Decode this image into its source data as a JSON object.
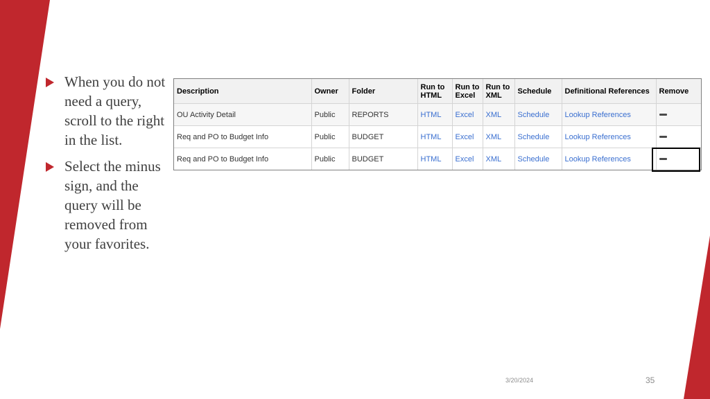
{
  "slide": {
    "bullets": [
      "When you do not need a query, scroll to the right in the list.",
      "Select the minus sign, and the query will be removed from your favorites."
    ],
    "date": "3/20/2024",
    "page_number": "35",
    "accent_color": "#c0272d"
  },
  "favorites_table": {
    "headers": {
      "description": "Description",
      "owner": "Owner",
      "folder": "Folder",
      "run_html": "Run to HTML",
      "run_excel": "Run to Excel",
      "run_xml": "Run to XML",
      "schedule": "Schedule",
      "definitional_references": "Definitional References",
      "remove": "Remove"
    },
    "rows": [
      {
        "description": "OU Activity Detail",
        "owner": "Public",
        "folder": "REPORTS",
        "html": "HTML",
        "excel": "Excel",
        "xml": "XML",
        "schedule": "Schedule",
        "lookup": "Lookup References",
        "remove_icon": "minus-icon"
      },
      {
        "description": "Req and PO to Budget Info",
        "owner": "Public",
        "folder": "BUDGET",
        "html": "HTML",
        "excel": "Excel",
        "xml": "XML",
        "schedule": "Schedule",
        "lookup": "Lookup References",
        "remove_icon": "minus-icon"
      },
      {
        "description": "Req and PO to Budget Info",
        "owner": "Public",
        "folder": "BUDGET",
        "html": "HTML",
        "excel": "Excel",
        "xml": "XML",
        "schedule": "Schedule",
        "lookup": "Lookup References",
        "remove_icon": "minus-icon"
      }
    ]
  }
}
